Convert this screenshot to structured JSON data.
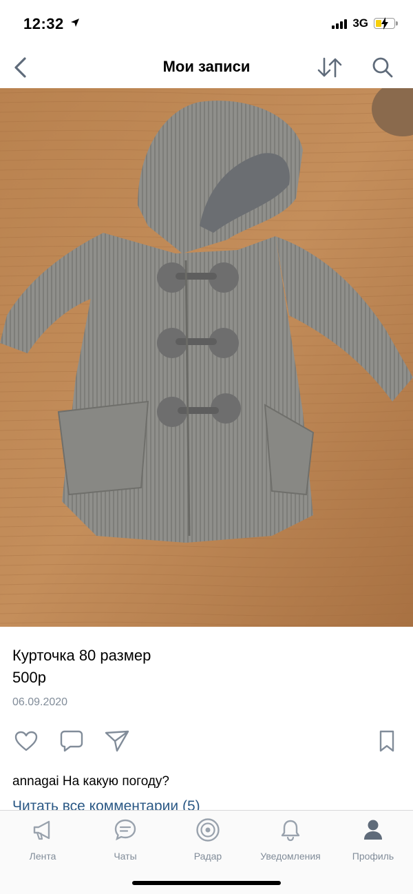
{
  "status": {
    "time": "12:32",
    "network": "3G"
  },
  "nav": {
    "title": "Мои записи"
  },
  "post": {
    "title_line": "Курточка 80 размер",
    "price_line": "500р",
    "date": "06.09.2020"
  },
  "comment": {
    "author": "annagai",
    "text": "На какую погоду?"
  },
  "read_all": "Читать все комментарии (5)",
  "tabs": [
    {
      "label": "Лента",
      "icon": "megaphone-icon"
    },
    {
      "label": "Чаты",
      "icon": "chat-bubble-icon"
    },
    {
      "label": "Радар",
      "icon": "radar-icon"
    },
    {
      "label": "Уведомления",
      "icon": "bell-icon"
    },
    {
      "label": "Профиль",
      "icon": "person-icon"
    }
  ],
  "colors": {
    "accent": "#2a5885",
    "muted": "#818c99",
    "icon": "#3f8ae0"
  }
}
